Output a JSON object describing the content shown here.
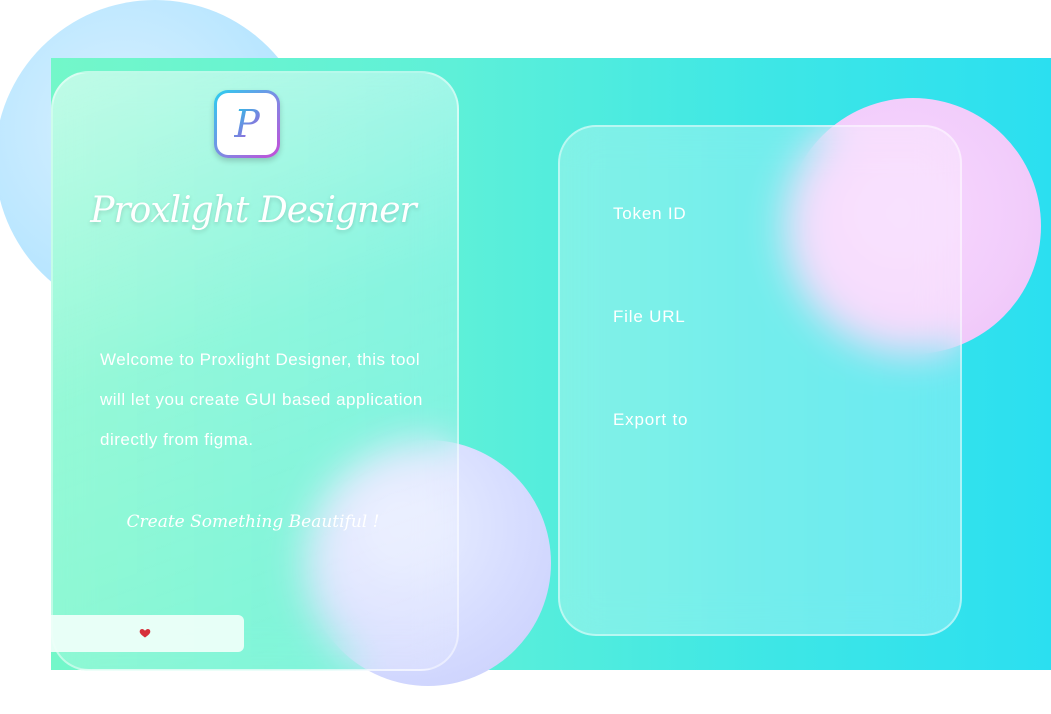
{
  "app": {
    "title": "Proxlight Designer",
    "logo_letter": "P"
  },
  "left_panel": {
    "welcome": "Welcome to Proxlight Designer, this tool will let you create GUI based application directly from figma.",
    "tagline": "Create Something Beautiful !",
    "footer_icon": "heart-icon"
  },
  "form": {
    "token_label": "Token ID",
    "url_label": "File URL",
    "export_label": "Export to"
  },
  "colors": {
    "background_start": "#73f7c9",
    "background_end": "#2bdff0",
    "heart": "#d6303a"
  }
}
